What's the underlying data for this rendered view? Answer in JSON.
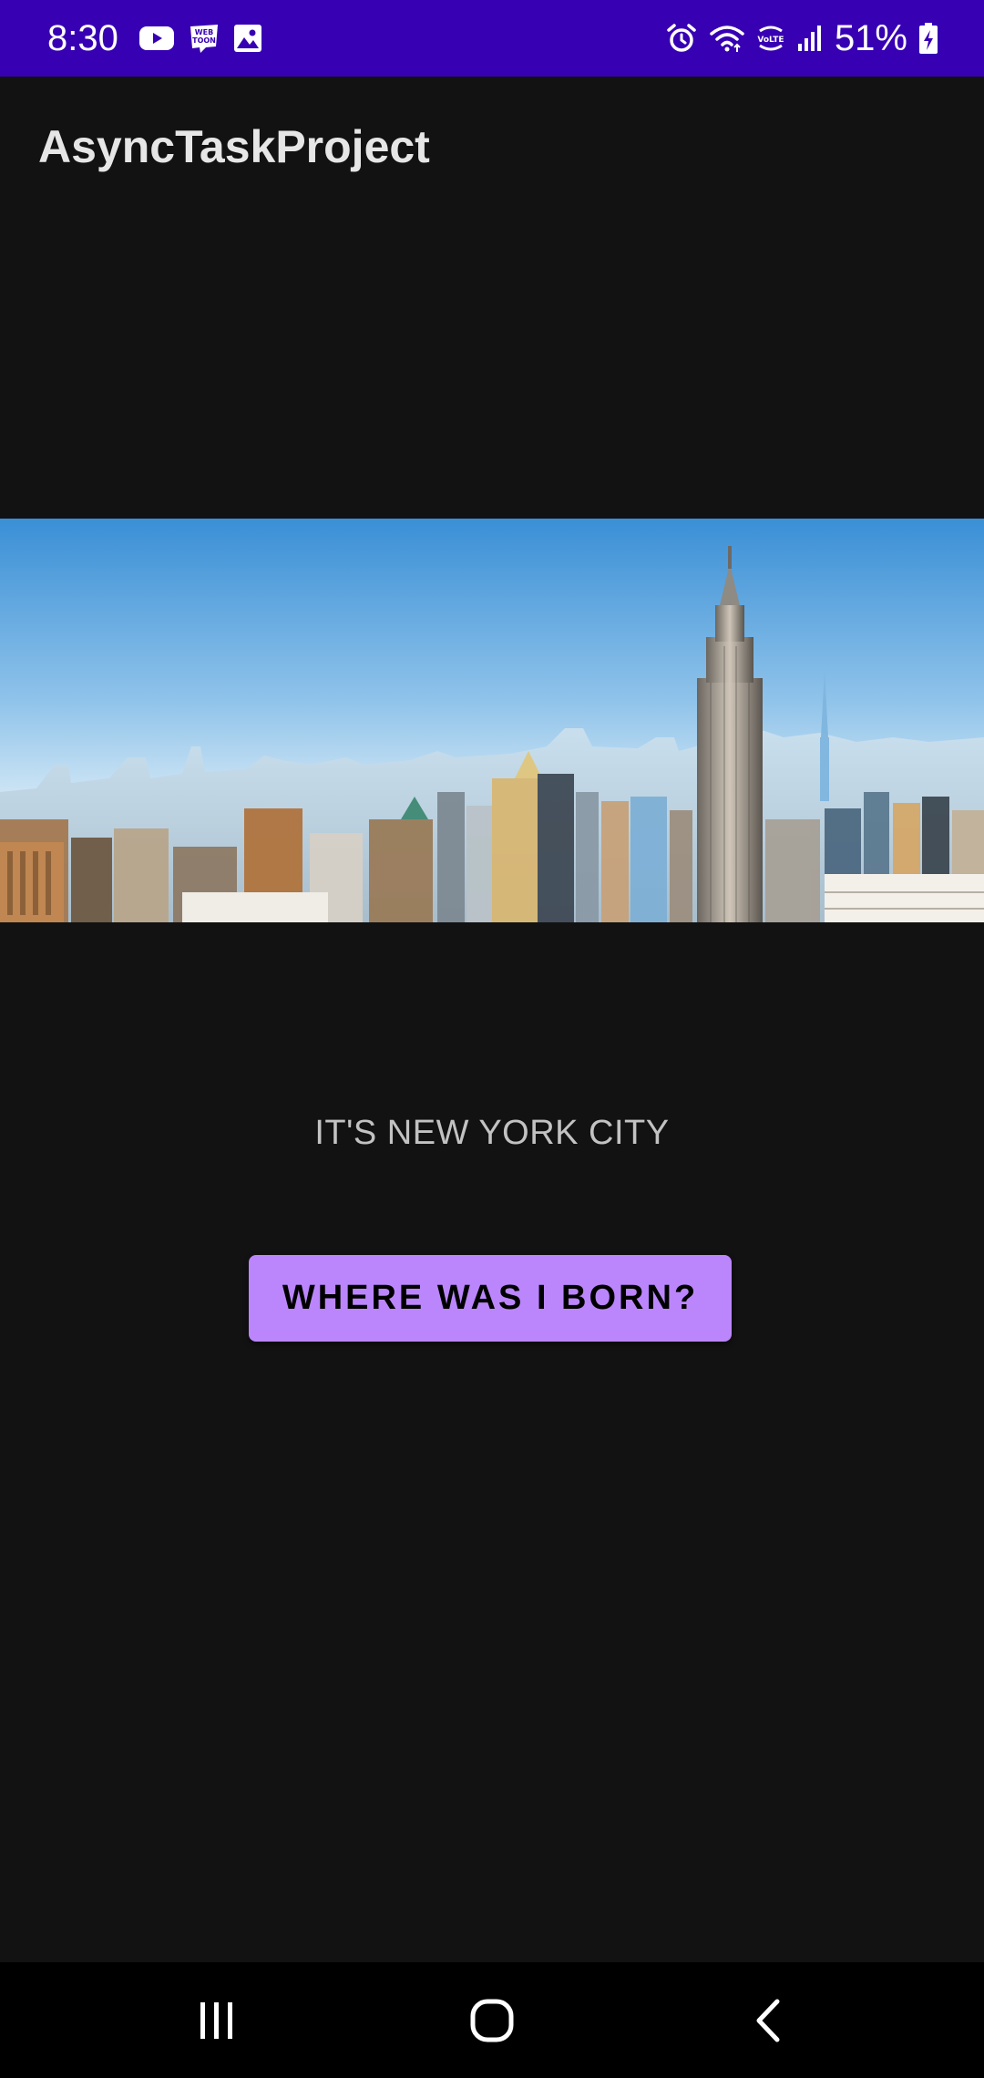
{
  "status_bar": {
    "time": "8:30",
    "battery_percent": "51%",
    "left_icons": [
      "youtube-icon",
      "webtoon-icon",
      "gallery-icon"
    ],
    "right_icons": [
      "alarm-icon",
      "wifi-icon",
      "volte-icon",
      "signal-icon",
      "battery-charging-icon"
    ],
    "background_color": "#3700b3"
  },
  "app_bar": {
    "title": "AsyncTaskProject"
  },
  "main": {
    "image_description": "city-skyline-image",
    "result_text": "IT'S NEW YORK CITY",
    "button_label": "WHERE WAS I BORN?",
    "button_color": "#bb86fc"
  },
  "nav_bar": {
    "icons": [
      "recents-icon",
      "home-icon",
      "back-icon"
    ]
  }
}
